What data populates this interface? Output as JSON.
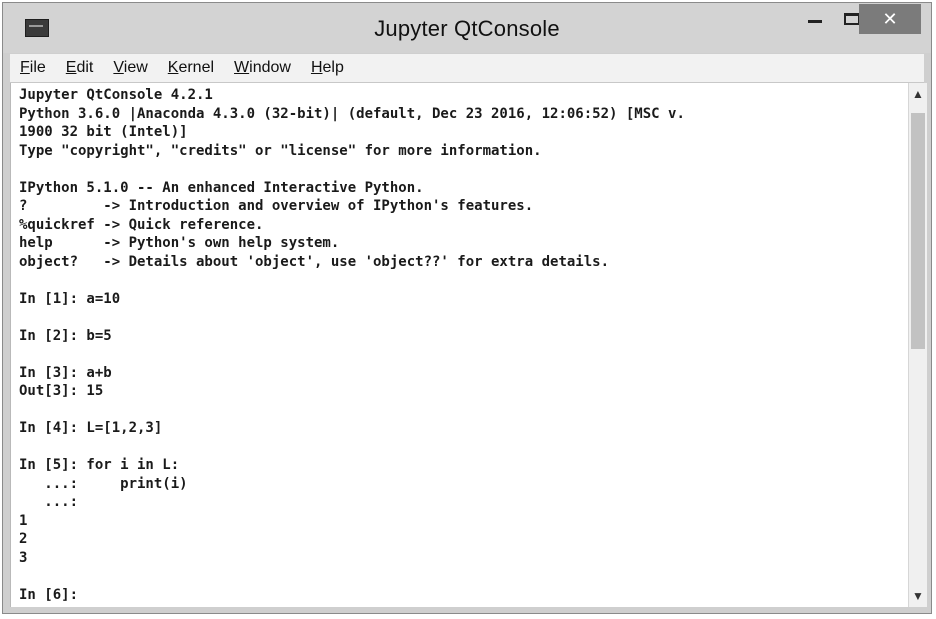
{
  "window": {
    "title": "Jupyter QtConsole",
    "icon": "qtconsole-app-icon",
    "controls": {
      "minimize": "–",
      "maximize": "☐",
      "close": "✕"
    }
  },
  "menu": [
    {
      "prefix": "",
      "underline": "F",
      "rest": "ile"
    },
    {
      "prefix": "",
      "underline": "E",
      "rest": "dit"
    },
    {
      "prefix": "",
      "underline": "V",
      "rest": "iew"
    },
    {
      "prefix": "",
      "underline": "K",
      "rest": "ernel"
    },
    {
      "prefix": "",
      "underline": "W",
      "rest": "indow"
    },
    {
      "prefix": "",
      "underline": "H",
      "rest": "elp"
    }
  ],
  "console": {
    "lines": [
      "Jupyter QtConsole 4.2.1",
      "Python 3.6.0 |Anaconda 4.3.0 (32-bit)| (default, Dec 23 2016, 12:06:52) [MSC v.",
      "1900 32 bit (Intel)]",
      "Type \"copyright\", \"credits\" or \"license\" for more information.",
      "",
      "IPython 5.1.0 -- An enhanced Interactive Python.",
      "?         -> Introduction and overview of IPython's features.",
      "%quickref -> Quick reference.",
      "help      -> Python's own help system.",
      "object?   -> Details about 'object', use 'object??' for extra details.",
      "",
      "In [1]: a=10",
      "",
      "In [2]: b=5",
      "",
      "In [3]: a+b",
      "Out[3]: 15",
      "",
      "In [4]: L=[1,2,3]",
      "",
      "In [5]: for i in L:",
      "   ...:     print(i)",
      "   ...:",
      "1",
      "2",
      "3",
      "",
      "In [6]:"
    ]
  },
  "scrollbar": {
    "up": "▲",
    "down": "▼"
  }
}
